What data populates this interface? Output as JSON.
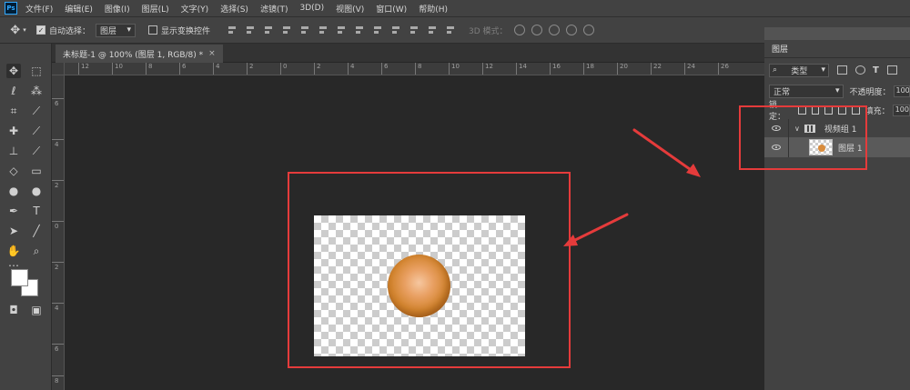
{
  "app": {
    "logo": "Ps"
  },
  "menu": [
    "文件(F)",
    "编辑(E)",
    "图像(I)",
    "图层(L)",
    "文字(Y)",
    "选择(S)",
    "滤镜(T)",
    "3D(D)",
    "视图(V)",
    "窗口(W)",
    "帮助(H)"
  ],
  "options": {
    "tool_icon": "move-icon",
    "auto_select_label": "自动选择：",
    "auto_select_checked": true,
    "auto_select_target": "图层",
    "show_transform_label": "显示变换控件",
    "show_transform_checked": false,
    "mode_3d_label": "3D 模式："
  },
  "document": {
    "tab_title": "未标题-1 @ 100% (图层 1, RGB/8) *",
    "close_glyph": "×"
  },
  "rulers": {
    "horizontal": [
      "12",
      "10",
      "8",
      "6",
      "4",
      "2",
      "0",
      "2",
      "4",
      "6",
      "8",
      "10",
      "12",
      "14",
      "16",
      "18",
      "20",
      "22",
      "24",
      "26"
    ],
    "vertical": [
      "6",
      "4",
      "2",
      "0",
      "2",
      "4",
      "6",
      "8"
    ]
  },
  "layers_panel": {
    "title": "图层",
    "filter_kind": "类型",
    "filter_letter": "T",
    "blend_mode": "正常",
    "opacity_label": "不透明度：",
    "opacity_value": "100",
    "lock_label": "锁定：",
    "fill_label": "填充：",
    "fill_value": "100",
    "layers": [
      {
        "name": "视频组 1",
        "type": "video-group",
        "visible": true
      },
      {
        "name": "图层 1",
        "type": "layer",
        "visible": true,
        "selected": true
      }
    ]
  },
  "colors": {
    "annotation": "#e53b3b",
    "ball": "#d2842e",
    "canvas_bg": "#282828",
    "panel_bg": "#424242"
  }
}
